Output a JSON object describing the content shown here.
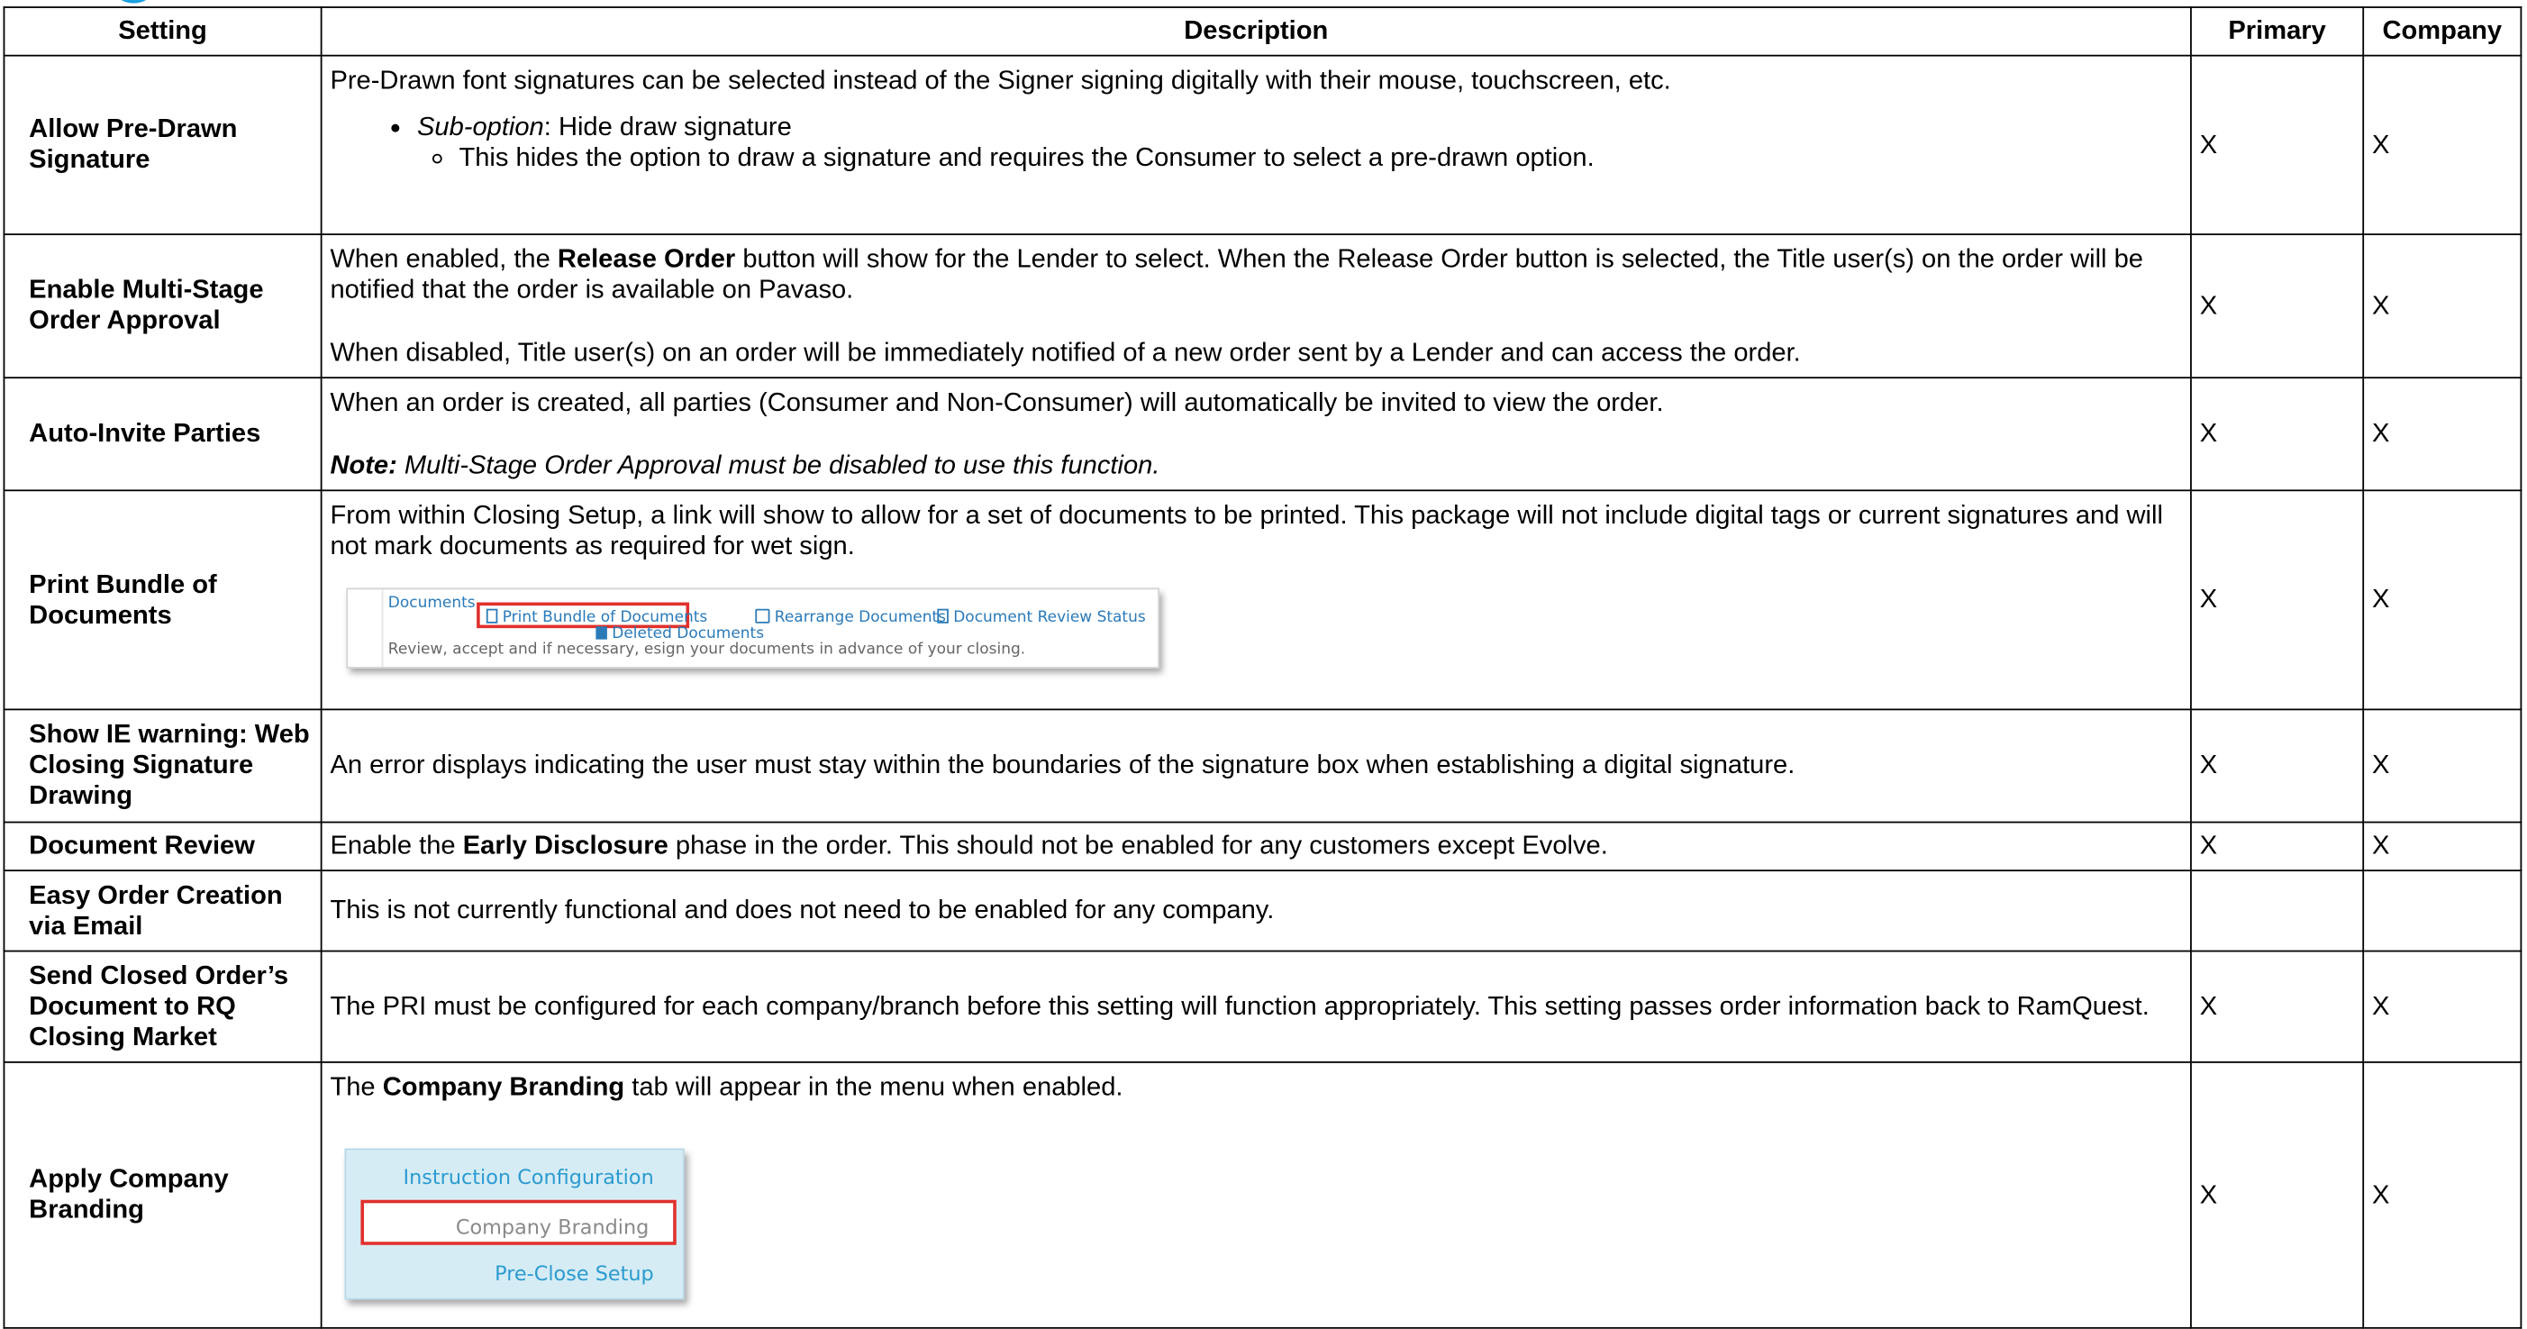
{
  "columns": {
    "setting": "Setting",
    "description": "Description",
    "primary": "Primary",
    "company": "Company"
  },
  "rows": [
    {
      "setting": "Allow Pre-Drawn Signature",
      "desc_p1": "Pre-Drawn font signatures can be selected instead of the Signer signing digitally with their mouse, touchscreen, etc.",
      "sub_label": "Sub-option",
      "sub_text": ": Hide draw signature",
      "sub_detail": "This hides the option to draw a signature and requires the Consumer to select a pre-drawn option.",
      "primary": "X",
      "company": "X"
    },
    {
      "setting": "Enable Multi-Stage Order Approval",
      "p1_a": "When enabled, the ",
      "p1_b": "Release Order",
      "p1_c": " button will show for the Lender to select. When the Release Order button is selected, the Title user(s) on the order will be notified that the order is available on Pavaso.",
      "p2": "When disabled, Title user(s) on an order will be immediately notified of a new order sent by a Lender and can access the order.",
      "primary": "X",
      "company": "X"
    },
    {
      "setting": "Auto-Invite Parties",
      "p1": "When an order is created, all parties (Consumer and Non-Consumer) will automatically be invited to view the order.",
      "note_label": "Note:",
      "note_text": " Multi-Stage Order Approval must be disabled to use this function.",
      "primary": "X",
      "company": "X"
    },
    {
      "setting": "Print Bundle of Documents",
      "p1": "From within Closing Setup, a link will show to allow for a set of documents to be printed. This package will not include digital tags or current signatures and will not mark documents as required for wet sign.",
      "shot": {
        "documents": "Documents",
        "print_bundle": "Print Bundle of Documents",
        "rearrange": "Rearrange Documents",
        "review_status": "Document Review Status",
        "deleted": "Deleted Documents",
        "hint": "Review, accept and if necessary, esign your documents in advance of your closing."
      },
      "primary": "X",
      "company": "X"
    },
    {
      "setting": "Show IE warning: Web Closing Signature Drawing",
      "p1": "An error displays indicating the user must stay within the boundaries of the signature box when establishing a digital signature.",
      "primary": "X",
      "company": "X"
    },
    {
      "setting": "Document Review",
      "p1_a": "Enable the ",
      "p1_b": "Early Disclosure",
      "p1_c": " phase in the order. This should not be enabled for any customers except Evolve.",
      "primary": "X",
      "company": "X"
    },
    {
      "setting": "Easy Order Creation via Email",
      "p1": "This is not currently functional and does not need to be enabled for any company.",
      "primary": "",
      "company": ""
    },
    {
      "setting": "Send Closed Order’s Document to RQ Closing Market",
      "p1": "The PRI must be configured for each company/branch before this setting will function appropriately. This setting passes order information back to RamQuest.",
      "primary": "X",
      "company": "X"
    },
    {
      "setting": "Apply Company Branding",
      "p1_a": "The ",
      "p1_b": "Company Branding",
      "p1_c": " tab will appear in the menu when enabled.",
      "menu": {
        "item1": "Instruction Configuration",
        "item2": "Company Branding",
        "item3": "Pre-Close Setup"
      },
      "primary": "X",
      "company": "X"
    }
  ]
}
